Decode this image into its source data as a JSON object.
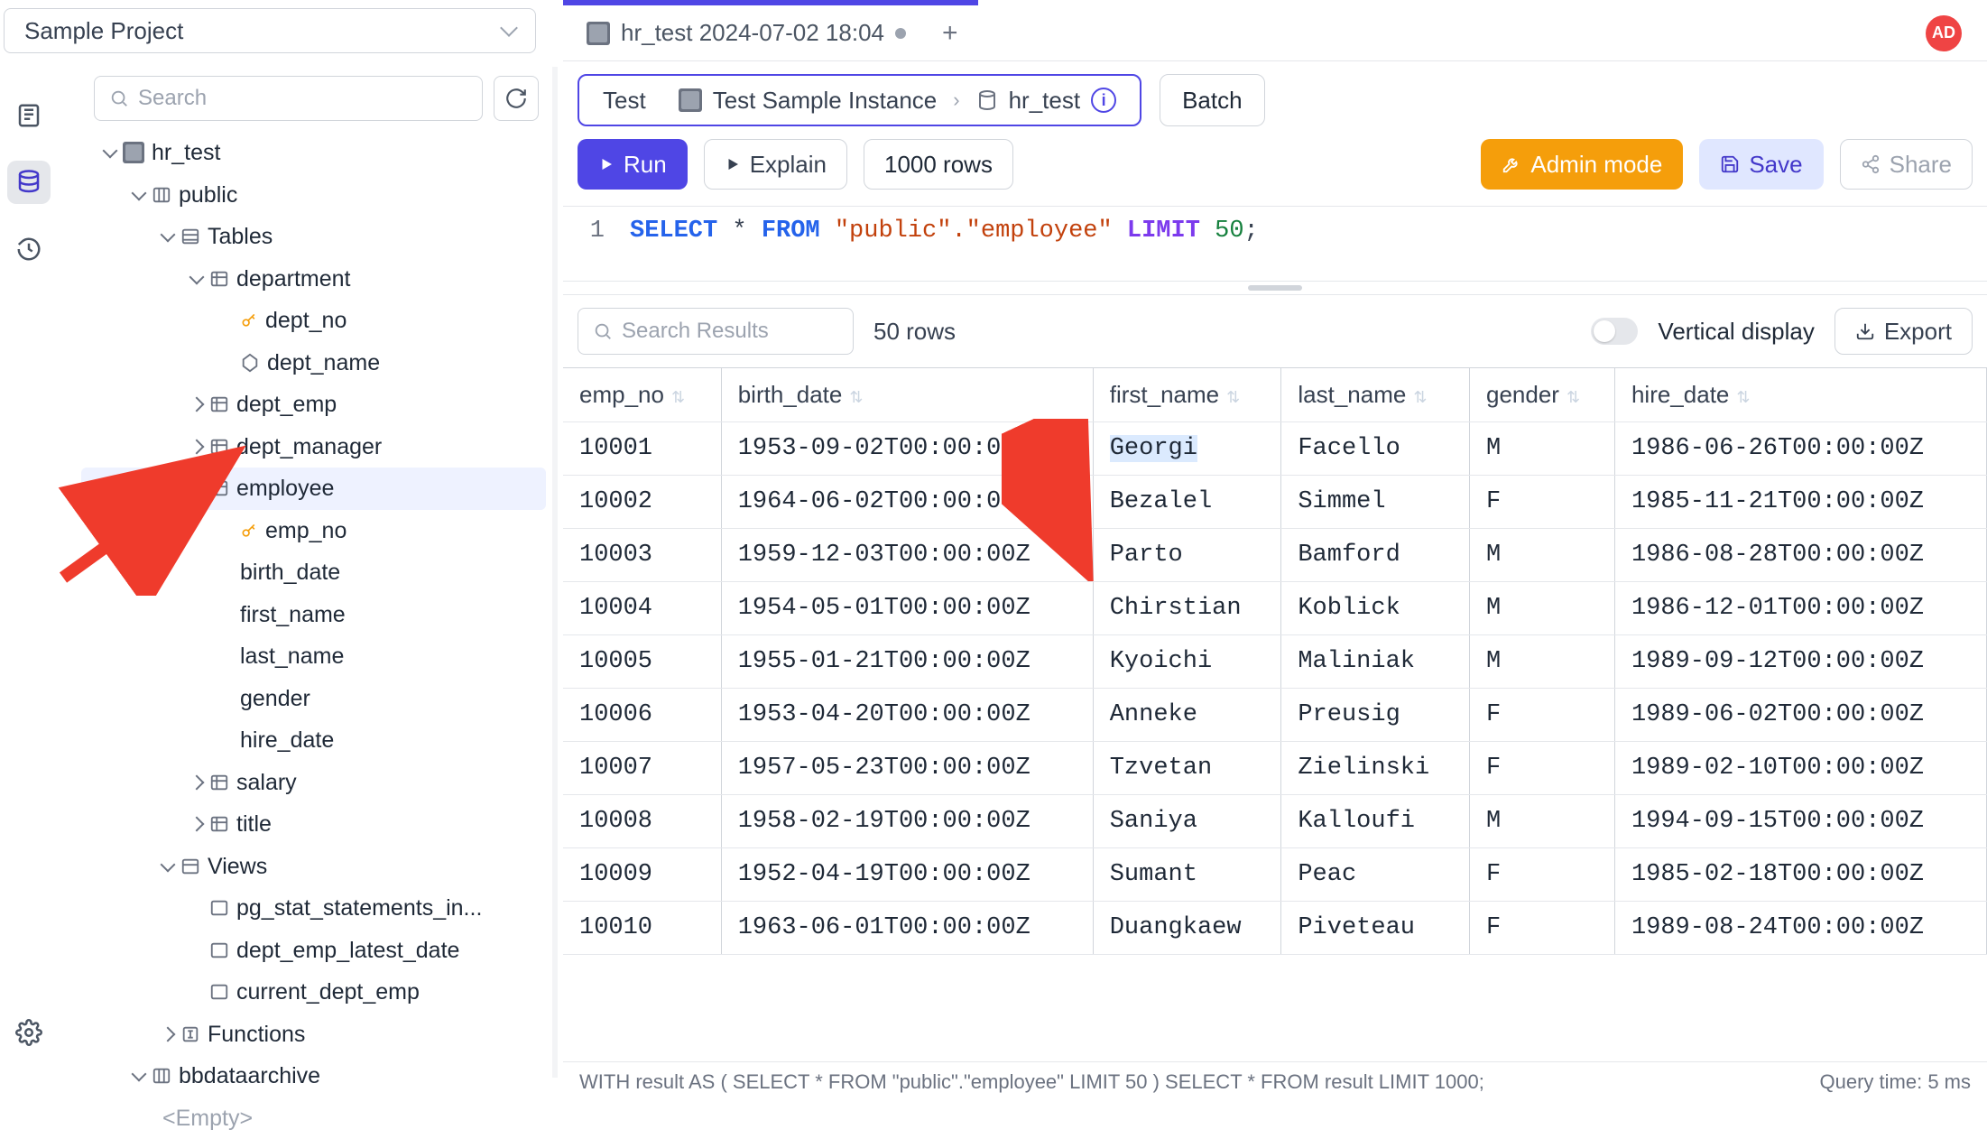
{
  "project_selector": {
    "value": "Sample Project"
  },
  "avatar": "AD",
  "sidebar": {
    "search_placeholder": "Search",
    "db_name": "hr_test",
    "schema_name": "public",
    "tables_label": "Tables",
    "tables": {
      "department": {
        "name": "department",
        "cols": [
          "dept_no",
          "dept_name"
        ]
      },
      "dept_emp": {
        "name": "dept_emp"
      },
      "dept_manager": {
        "name": "dept_manager"
      },
      "employee": {
        "name": "employee",
        "pk": "emp_no",
        "cols": [
          "birth_date",
          "first_name",
          "last_name",
          "gender",
          "hire_date"
        ]
      },
      "salary": {
        "name": "salary"
      },
      "title": {
        "name": "title"
      }
    },
    "views_label": "Views",
    "views": [
      "pg_stat_statements_in...",
      "dept_emp_latest_date",
      "current_dept_emp"
    ],
    "functions_label": "Functions",
    "other_schema": "bbdataarchive",
    "empty_label": "<Empty>"
  },
  "tab": {
    "title": "hr_test 2024-07-02 18:04"
  },
  "breadcrumb": {
    "seg1": "Test",
    "seg2": "Test Sample Instance",
    "seg3": "hr_test"
  },
  "batch_label": "Batch",
  "toolbar": {
    "run": "Run",
    "explain": "Explain",
    "rows_limit": "1000 rows",
    "admin": "Admin mode",
    "save": "Save",
    "share": "Share"
  },
  "editor": {
    "line_no": "1",
    "tokens": [
      "SELECT",
      "*",
      "FROM",
      "\"public\".\"employee\"",
      "LIMIT",
      "50",
      ";"
    ]
  },
  "results_bar": {
    "search_placeholder": "Search Results",
    "row_count": "50 rows",
    "vertical_label": "Vertical display",
    "export_label": "Export"
  },
  "columns": [
    "emp_no",
    "birth_date",
    "first_name",
    "last_name",
    "gender",
    "hire_date"
  ],
  "rows": [
    [
      "10001",
      "1953-09-02T00:00:00Z",
      "Georgi",
      "Facello",
      "M",
      "1986-06-26T00:00:00Z"
    ],
    [
      "10002",
      "1964-06-02T00:00:00Z",
      "Bezalel",
      "Simmel",
      "F",
      "1985-11-21T00:00:00Z"
    ],
    [
      "10003",
      "1959-12-03T00:00:00Z",
      "Parto",
      "Bamford",
      "M",
      "1986-08-28T00:00:00Z"
    ],
    [
      "10004",
      "1954-05-01T00:00:00Z",
      "Chirstian",
      "Koblick",
      "M",
      "1986-12-01T00:00:00Z"
    ],
    [
      "10005",
      "1955-01-21T00:00:00Z",
      "Kyoichi",
      "Maliniak",
      "M",
      "1989-09-12T00:00:00Z"
    ],
    [
      "10006",
      "1953-04-20T00:00:00Z",
      "Anneke",
      "Preusig",
      "F",
      "1989-06-02T00:00:00Z"
    ],
    [
      "10007",
      "1957-05-23T00:00:00Z",
      "Tzvetan",
      "Zielinski",
      "F",
      "1989-02-10T00:00:00Z"
    ],
    [
      "10008",
      "1958-02-19T00:00:00Z",
      "Saniya",
      "Kalloufi",
      "M",
      "1994-09-15T00:00:00Z"
    ],
    [
      "10009",
      "1952-04-19T00:00:00Z",
      "Sumant",
      "Peac",
      "F",
      "1985-02-18T00:00:00Z"
    ],
    [
      "10010",
      "1963-06-01T00:00:00Z",
      "Duangkaew",
      "Piveteau",
      "F",
      "1989-08-24T00:00:00Z"
    ]
  ],
  "footer": {
    "query": "WITH result AS ( SELECT * FROM \"public\".\"employee\" LIMIT 50 ) SELECT * FROM result LIMIT 1000;",
    "time": "Query time: 5 ms"
  }
}
